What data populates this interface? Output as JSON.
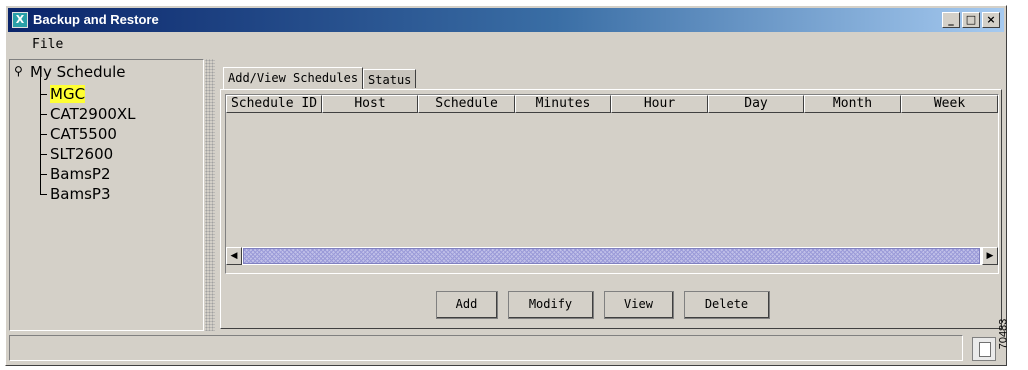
{
  "window": {
    "title": "Backup and Restore",
    "app_icon_glyph": "X",
    "controls": {
      "minimize": "_",
      "maximize": "□",
      "close": "×"
    }
  },
  "menubar": {
    "file": "File"
  },
  "tree": {
    "root": "My Schedule",
    "items": [
      {
        "label": "MGC",
        "selected": true
      },
      {
        "label": "CAT2900XL",
        "selected": false
      },
      {
        "label": "CAT5500",
        "selected": false
      },
      {
        "label": "SLT2600",
        "selected": false
      },
      {
        "label": "BamsP2",
        "selected": false
      },
      {
        "label": "BamsP3",
        "selected": false
      }
    ]
  },
  "tabs": [
    {
      "label": "Add/View Schedules",
      "active": true
    },
    {
      "label": "Status",
      "active": false
    }
  ],
  "table": {
    "columns": [
      "Schedule ID",
      "Host",
      "Schedule",
      "Minutes",
      "Hour",
      "Day",
      "Month",
      "Week"
    ],
    "rows": []
  },
  "buttons": {
    "add": "Add",
    "modify": "Modify",
    "view": "View",
    "delete": "Delete"
  },
  "status": {
    "text": ""
  },
  "figure_number": "70483",
  "colors": {
    "title_bar": "#0a246a",
    "selected_highlight": "#ffff33",
    "window_bg": "#d4d0c8"
  }
}
